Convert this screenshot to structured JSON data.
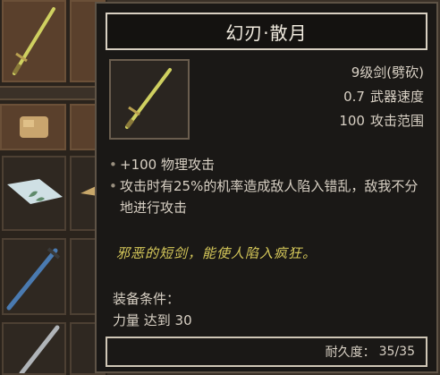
{
  "item": {
    "name": "幻刃·散月",
    "icon": "short-sword-icon",
    "grade": "9级剑(劈砍)",
    "speed_value": "0.7",
    "speed_label": "武器速度",
    "range_value": "100",
    "range_label": "攻击范围"
  },
  "effects": [
    "+100 物理攻击",
    "攻击时有25%的机率造成敌人陷入错乱，敌我不分地进行攻击"
  ],
  "flavor_text": "邪恶的短剑，能使人陷入疯狂。",
  "requirements": {
    "label": "装备条件：",
    "line": "力量 达到 30"
  },
  "durability": {
    "label": "耐久度：",
    "value": "35/35"
  },
  "inventory": {
    "icons": [
      "short-sword-icon",
      "satchel-icon",
      "scroll-herb-icon",
      "dagger-icon",
      "sword-icon"
    ]
  },
  "colors": {
    "panel_bg": "#1a1816",
    "flavor_text": "#d7c95a",
    "blade": "#cfd060"
  }
}
